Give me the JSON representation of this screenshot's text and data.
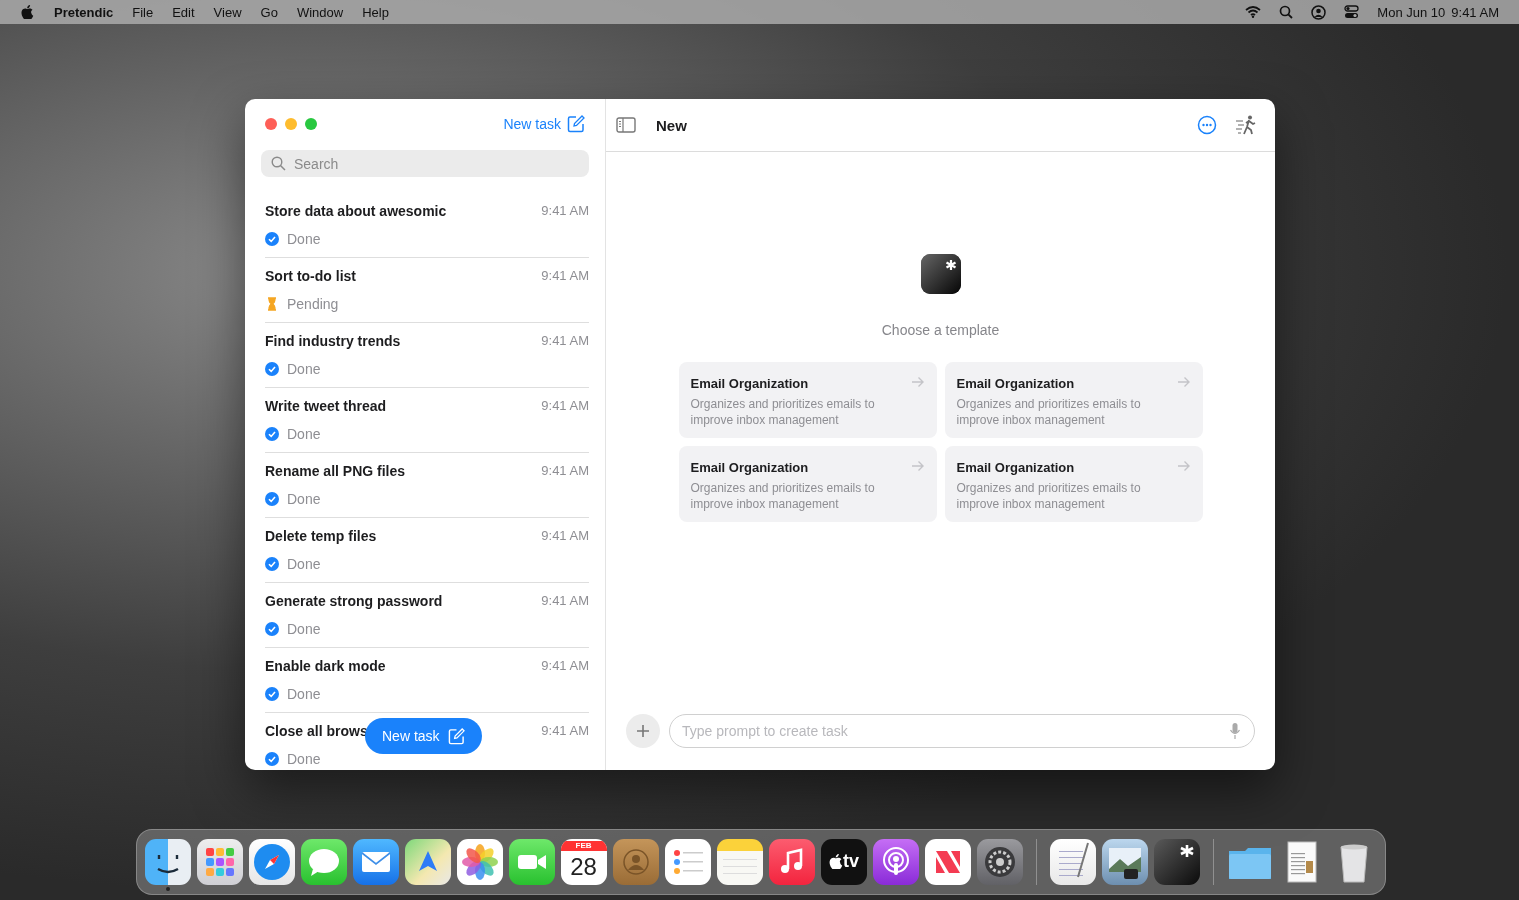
{
  "menu_bar": {
    "app_name": "Pretendic",
    "menus": [
      "File",
      "Edit",
      "View",
      "Go",
      "Window",
      "Help"
    ],
    "date": "Mon Jun 10",
    "time": "9:41 AM"
  },
  "sidebar": {
    "new_task_link": "New task",
    "search": {
      "placeholder": "Search"
    },
    "tasks": [
      {
        "title": "Store data about awesomic",
        "time": "9:41 AM",
        "kind": "done",
        "status_label": "Done"
      },
      {
        "title": "Sort to-do list",
        "time": "9:41 AM",
        "kind": "pending",
        "status_label": "Pending"
      },
      {
        "title": "Find industry trends",
        "time": "9:41 AM",
        "kind": "done",
        "status_label": "Done"
      },
      {
        "title": "Write tweet thread",
        "time": "9:41 AM",
        "kind": "done",
        "status_label": "Done"
      },
      {
        "title": "Rename all PNG files",
        "time": "9:41 AM",
        "kind": "done",
        "status_label": "Done"
      },
      {
        "title": "Delete temp files",
        "time": "9:41 AM",
        "kind": "done",
        "status_label": "Done"
      },
      {
        "title": "Generate strong password",
        "time": "9:41 AM",
        "kind": "done",
        "status_label": "Done"
      },
      {
        "title": "Enable dark mode",
        "time": "9:41 AM",
        "kind": "done",
        "status_label": "Done"
      },
      {
        "title": "Close all brows",
        "time": "9:41 AM",
        "kind": "done",
        "status_label": "Done"
      }
    ],
    "floating_button": "New task"
  },
  "main": {
    "title": "New",
    "prompt_heading": "Choose a template",
    "templates": [
      {
        "title": "Email Organization",
        "description": "Organizes and prioritizes emails to improve inbox management"
      },
      {
        "title": "Email Organization",
        "description": "Organizes and prioritizes emails to improve inbox management"
      },
      {
        "title": "Email Organization",
        "description": "Organizes and prioritizes emails to improve inbox management"
      },
      {
        "title": "Email Organization",
        "description": "Organizes and prioritizes emails to improve inbox management"
      }
    ],
    "prompt_field": {
      "placeholder": "Type prompt to create task"
    }
  },
  "dock": [
    {
      "kind": "finder",
      "running": true
    },
    {
      "kind": "launchpad",
      "running": false
    },
    {
      "kind": "safari",
      "running": false
    },
    {
      "kind": "messages",
      "running": false
    },
    {
      "kind": "mail",
      "running": false
    },
    {
      "kind": "maps",
      "running": false
    },
    {
      "kind": "photos",
      "running": false
    },
    {
      "kind": "facetime",
      "running": false
    },
    {
      "kind": "calendar",
      "running": false,
      "month": "FEB",
      "day": "28"
    },
    {
      "kind": "contacts",
      "running": false
    },
    {
      "kind": "reminders",
      "running": false
    },
    {
      "kind": "notes",
      "running": false
    },
    {
      "kind": "music",
      "running": false
    },
    {
      "kind": "tv",
      "running": false,
      "label": "tv"
    },
    {
      "kind": "podcasts",
      "running": false
    },
    {
      "kind": "news",
      "running": false
    },
    {
      "kind": "settings",
      "running": false
    },
    {
      "kind": "separator"
    },
    {
      "kind": "textedit",
      "running": false
    },
    {
      "kind": "preview",
      "running": false
    },
    {
      "kind": "app",
      "running": false
    },
    {
      "kind": "separator"
    },
    {
      "kind": "folder",
      "running": false
    },
    {
      "kind": "document",
      "running": false
    },
    {
      "kind": "trash",
      "running": false
    }
  ]
}
